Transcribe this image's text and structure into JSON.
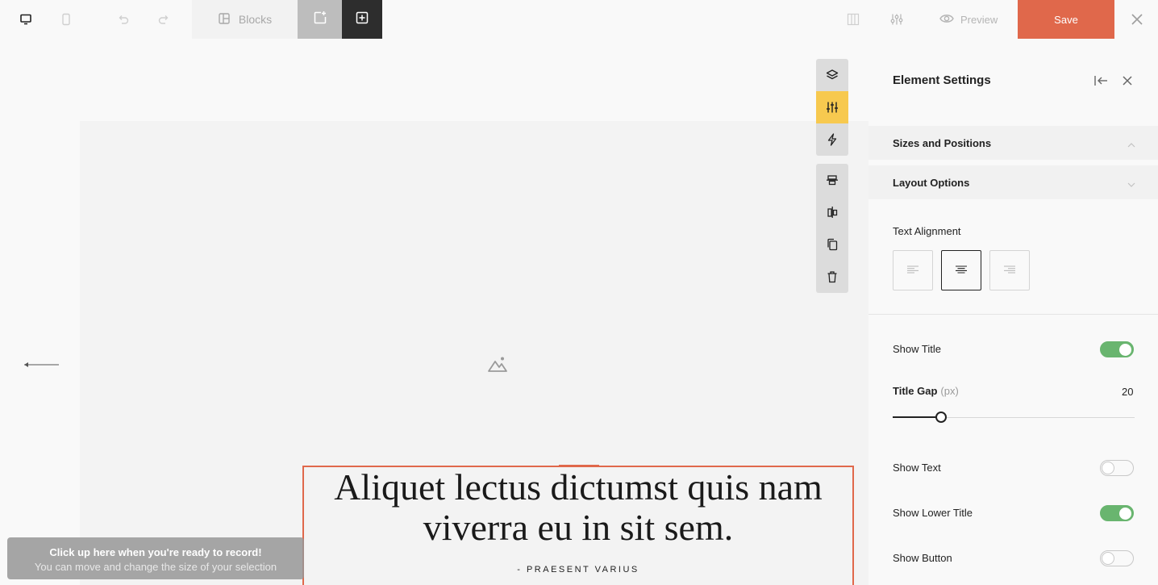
{
  "toolbar": {
    "blocks_label": "Blocks",
    "preview_label": "Preview",
    "save_label": "Save"
  },
  "canvas": {
    "quote_text": "Aliquet lectus dictumst quis nam viverra eu in sit sem.",
    "quote_author": "- PRAESENT VARIUS"
  },
  "tools": [
    "layers-icon",
    "sliders-icon",
    "lightning-icon",
    "align-vertical-center-icon",
    "align-horizontal-center-icon",
    "copy-icon",
    "trash-icon"
  ],
  "record_tip": {
    "title": "Click up here when you're ready to record!",
    "subtitle": "You can move and change the size of your selection"
  },
  "panel": {
    "title": "Element Settings",
    "sections": [
      {
        "label": "Sizes and Positions",
        "expanded": true
      },
      {
        "label": "Layout Options",
        "expanded": false
      }
    ],
    "text_alignment_label": "Text Alignment",
    "text_alignment_options": [
      "left",
      "center",
      "right"
    ],
    "text_alignment_selected": "center",
    "show_title_label": "Show Title",
    "show_title": true,
    "title_gap_label": "Title Gap",
    "title_gap_unit": "(px)",
    "title_gap_value": "20",
    "title_gap_fraction": 0.2,
    "show_text_label": "Show Text",
    "show_text": false,
    "show_lower_title_label": "Show Lower Title",
    "show_lower_title": true,
    "show_button_label": "Show Button",
    "show_button": false
  },
  "colors": {
    "accent": "#e0684b",
    "active_tool": "#f7c94f",
    "toggle_on": "#69b56f"
  }
}
